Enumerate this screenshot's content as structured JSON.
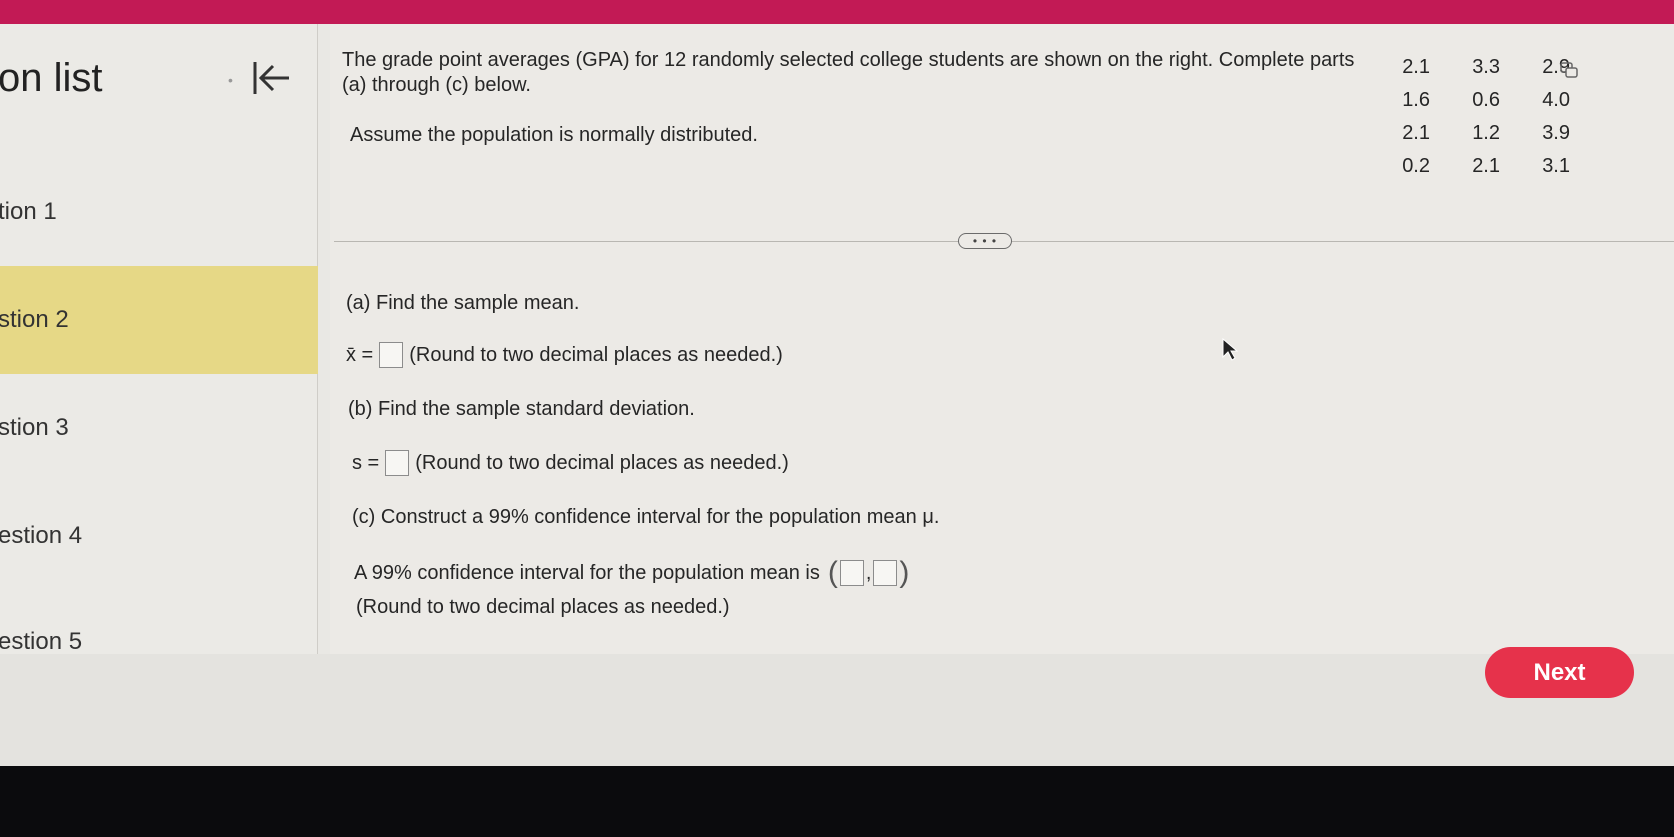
{
  "sidebar": {
    "title": "on list",
    "items": [
      {
        "label": "tion 1"
      },
      {
        "label": "stion 2"
      },
      {
        "label": "stion 3"
      },
      {
        "label": "estion 4"
      },
      {
        "label": "estion 5"
      }
    ]
  },
  "problem": {
    "prompt": "The grade point averages (GPA) for 12 randomly selected college students are shown on the right. Complete parts (a) through (c) below.",
    "assumption": "Assume the population is normally distributed.",
    "data": [
      [
        "2.1",
        "3.3",
        "2.9"
      ],
      [
        "1.6",
        "0.6",
        "4.0"
      ],
      [
        "2.1",
        "1.2",
        "3.9"
      ],
      [
        "0.2",
        "2.1",
        "3.1"
      ]
    ],
    "more_label": "• • •"
  },
  "parts": {
    "a_label": "(a) Find the sample mean.",
    "a_var": "x̄ =",
    "a_hint": "(Round to two decimal places as needed.)",
    "b_label": "(b) Find the sample standard deviation.",
    "b_var": "s =",
    "b_hint": "(Round to two decimal places as needed.)",
    "c_label": "(c) Construct a 99% confidence interval for the population mean μ.",
    "c_text": "A 99% confidence interval for the population mean is",
    "c_hint": "(Round to two decimal places as needed.)"
  },
  "footer": {
    "next_label": "Next"
  },
  "colors": {
    "topbar": "#c21a55",
    "active_item": "#e6d886",
    "next_button": "#e6324b"
  }
}
